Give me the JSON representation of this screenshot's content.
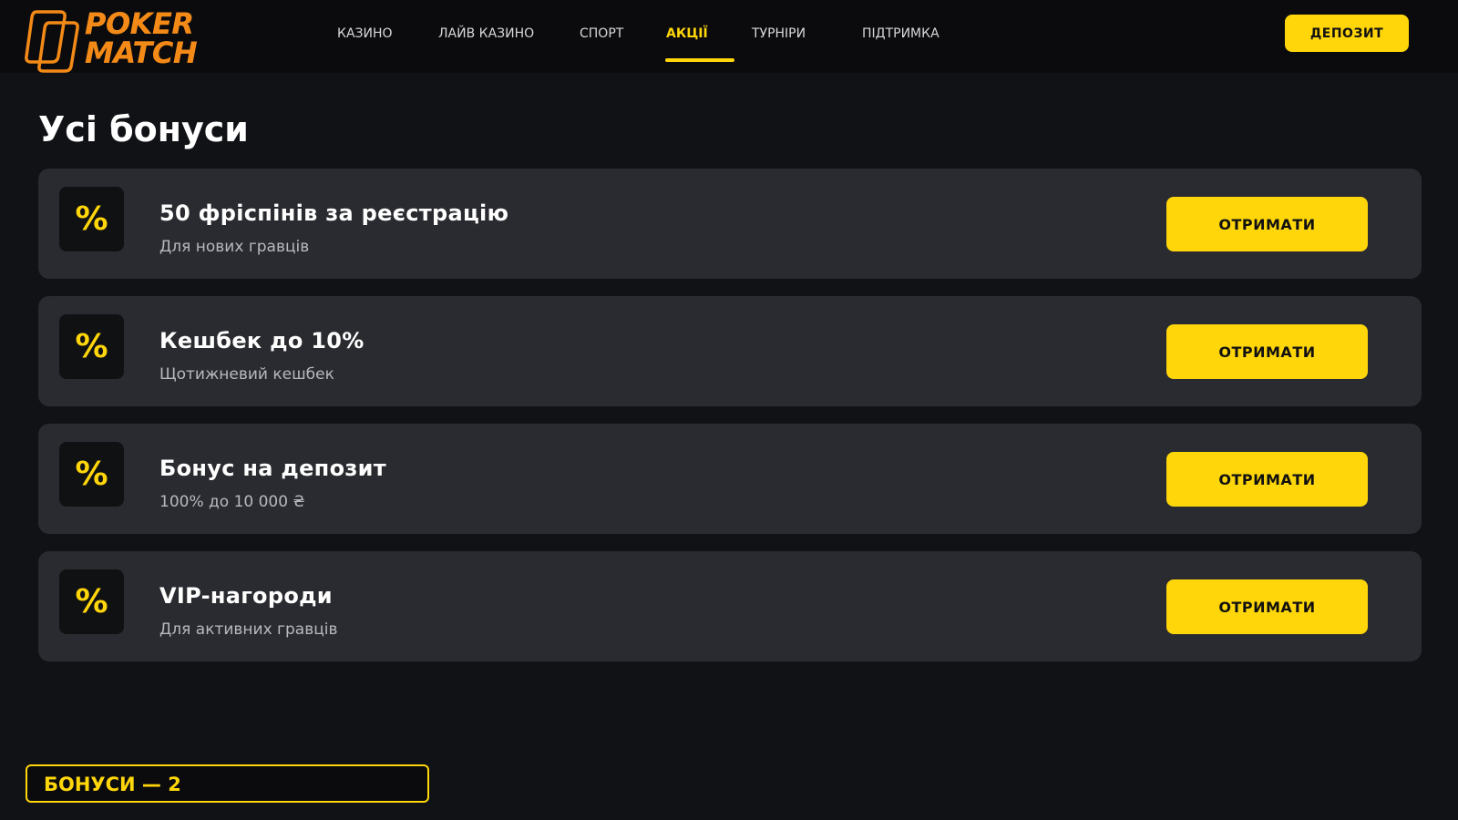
{
  "header": {
    "logo": {
      "line1": "POKER",
      "line2": "MATCH",
      "mark": "pokermatch-logo-mark"
    },
    "nav": [
      {
        "label": "КАЗИНО",
        "active": false
      },
      {
        "label": "ЛАЙВ КАЗИНО",
        "active": false
      },
      {
        "label": "СПОРТ",
        "active": false
      },
      {
        "label": "АКЦІЇ",
        "active": true
      },
      {
        "label": "ТУРНІРИ",
        "active": false
      },
      {
        "label": "ПІДТРИМКА",
        "active": false
      }
    ],
    "deposit_label": "ДЕПОЗИТ"
  },
  "main": {
    "title": "Усі бонуси",
    "bonuses": [
      {
        "icon": "%",
        "title": "50 фріспінів за реєстрацію",
        "subtitle": "Для нових гравців",
        "button": "ОТРИМАТИ"
      },
      {
        "icon": "%",
        "title": "Кешбек до 10%",
        "subtitle": "Щотижневий кешбек",
        "button": "ОТРИМАТИ"
      },
      {
        "icon": "%",
        "title": "Бонус на депозит",
        "subtitle": "100% до 10 000 ₴",
        "button": "ОТРИМАТИ"
      },
      {
        "icon": "%",
        "title": "VIP-нагороди",
        "subtitle": "Для активних гравців",
        "button": "ОТРИМАТИ"
      }
    ]
  },
  "footer_counter": {
    "text": "БОНУСИ — 2"
  },
  "colors": {
    "accent": "#ffd60a",
    "logo_orange": "#f38a17",
    "background": "#111216",
    "card": "#2a2b30"
  }
}
